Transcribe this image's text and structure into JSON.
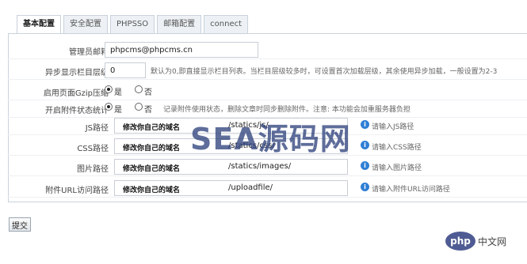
{
  "tabs": [
    "基本配置",
    "安全配置",
    "PHPSSO",
    "邮箱配置",
    "connect"
  ],
  "admin_email": {
    "label": "管理员邮箱",
    "value": "phpcms@phpcms.cn"
  },
  "async_level": {
    "label": "异步显示栏目层级",
    "value": "0",
    "hint": "默认为0,即直接显示栏目列表。当栏目层级较多时，可设置首次加载层级，其余使用异步加载，一般设置为2-3"
  },
  "gzip": {
    "label": "启用页面Gzip压缩",
    "yes": "是",
    "no": "否",
    "selected": "yes"
  },
  "attach_stat": {
    "label": "开启附件状态统计",
    "yes": "是",
    "no": "否",
    "selected": "yes",
    "hint": "记录附件使用状态，删除文章时同步删除附件。注意: 本功能会加重服务器负担"
  },
  "paths": [
    {
      "label": "JS路径",
      "domain": "修改你自己的域名",
      "path": "/statics/js/",
      "info": "请输入JS路径"
    },
    {
      "label": "CSS路径",
      "domain": "修改你自己的域名",
      "path": "/statics/css/",
      "info": "请输入CSS路径"
    },
    {
      "label": "图片路径",
      "domain": "修改你自己的域名",
      "path": "/statics/images/",
      "info": "请输入图片路径"
    },
    {
      "label": "附件URL访问路径",
      "domain": "修改你自己的域名",
      "path": "/uploadfile/",
      "info": "请输入附件URL访问路径"
    }
  ],
  "submit_label": "提交",
  "watermark": "SEA源码网",
  "php_logo": "php",
  "php_site": "中文网"
}
